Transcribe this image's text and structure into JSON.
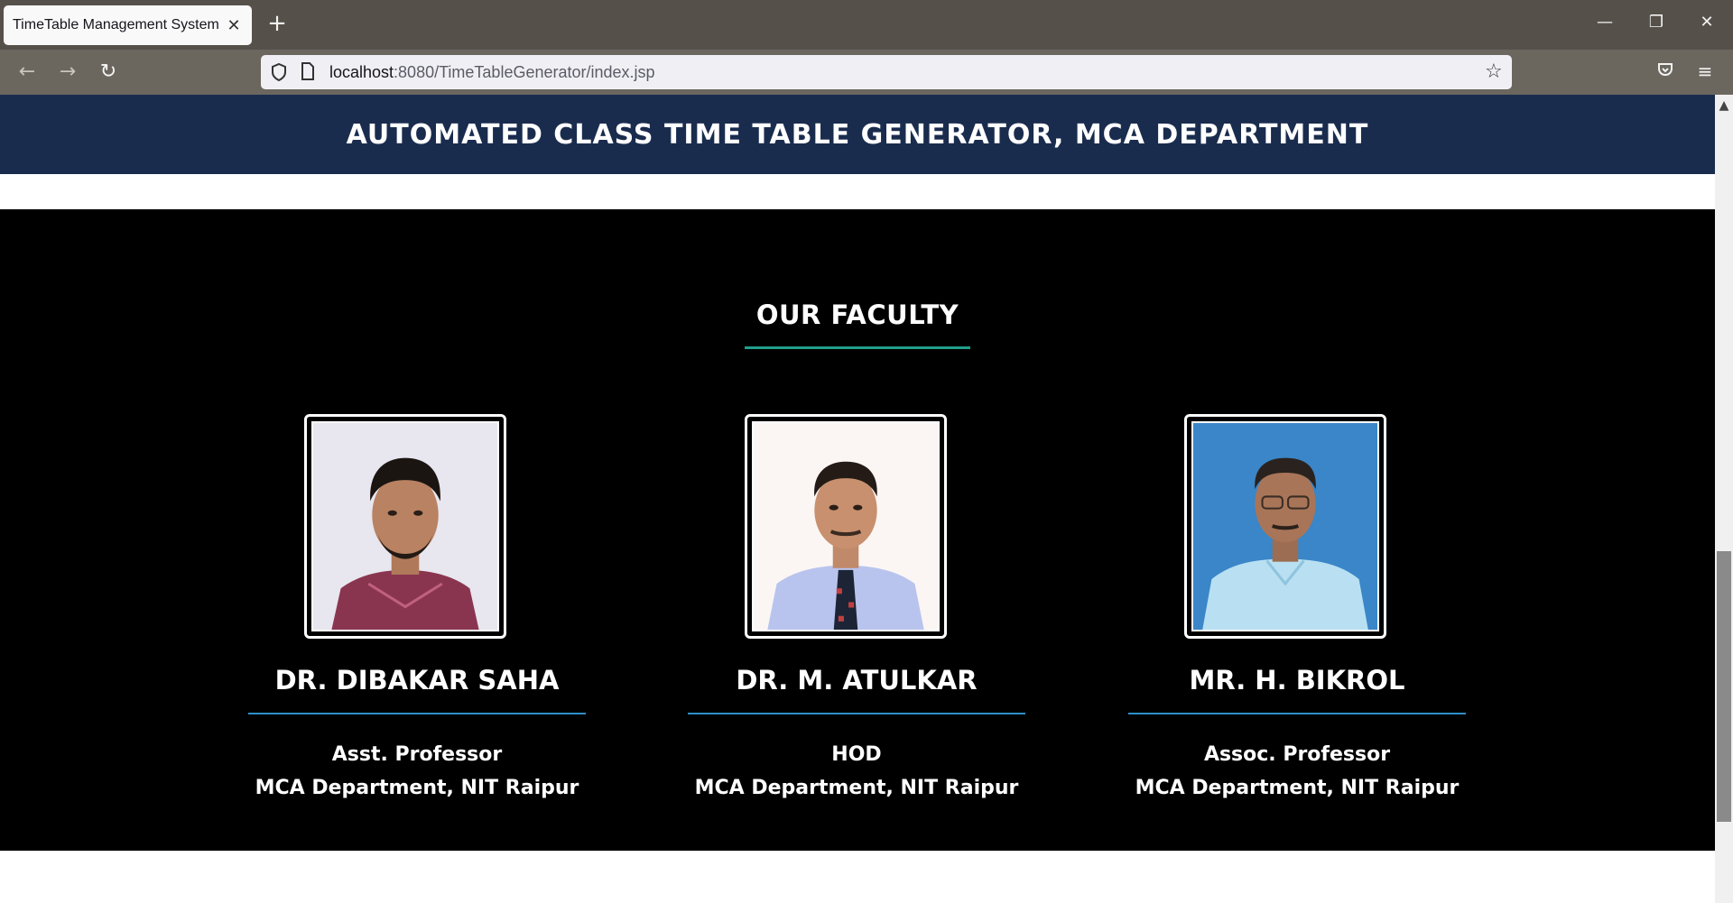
{
  "browser": {
    "tab_title": "TimeTable Management System",
    "tab_close": "✕",
    "new_tab": "+",
    "url_host": "localhost",
    "url_rest": ":8080/TimeTableGenerator/index.jsp",
    "icons": [
      "back-icon",
      "forward-icon",
      "reload-icon",
      "shield-icon",
      "page-icon",
      "star-icon",
      "pocket-icon",
      "menu-icon",
      "minimize-icon",
      "restore-icon",
      "close-window-icon"
    ]
  },
  "header": {
    "title": "AUTOMATED CLASS TIME TABLE GENERATOR, MCA DEPARTMENT",
    "background": "#1a2c4e"
  },
  "faculty": {
    "heading": "OUR FACULTY",
    "accent": "#1f9e8a",
    "members": [
      {
        "name": "DR. DIBAKAR SAHA",
        "role": "Asst. Professor",
        "department": "MCA Department, NIT Raipur"
      },
      {
        "name": "DR. M. ATULKAR",
        "role": "HOD",
        "department": "MCA Department, NIT Raipur"
      },
      {
        "name": "MR. H. BIKROL",
        "role": "Assoc. Professor",
        "department": "MCA Department, NIT Raipur"
      }
    ]
  }
}
